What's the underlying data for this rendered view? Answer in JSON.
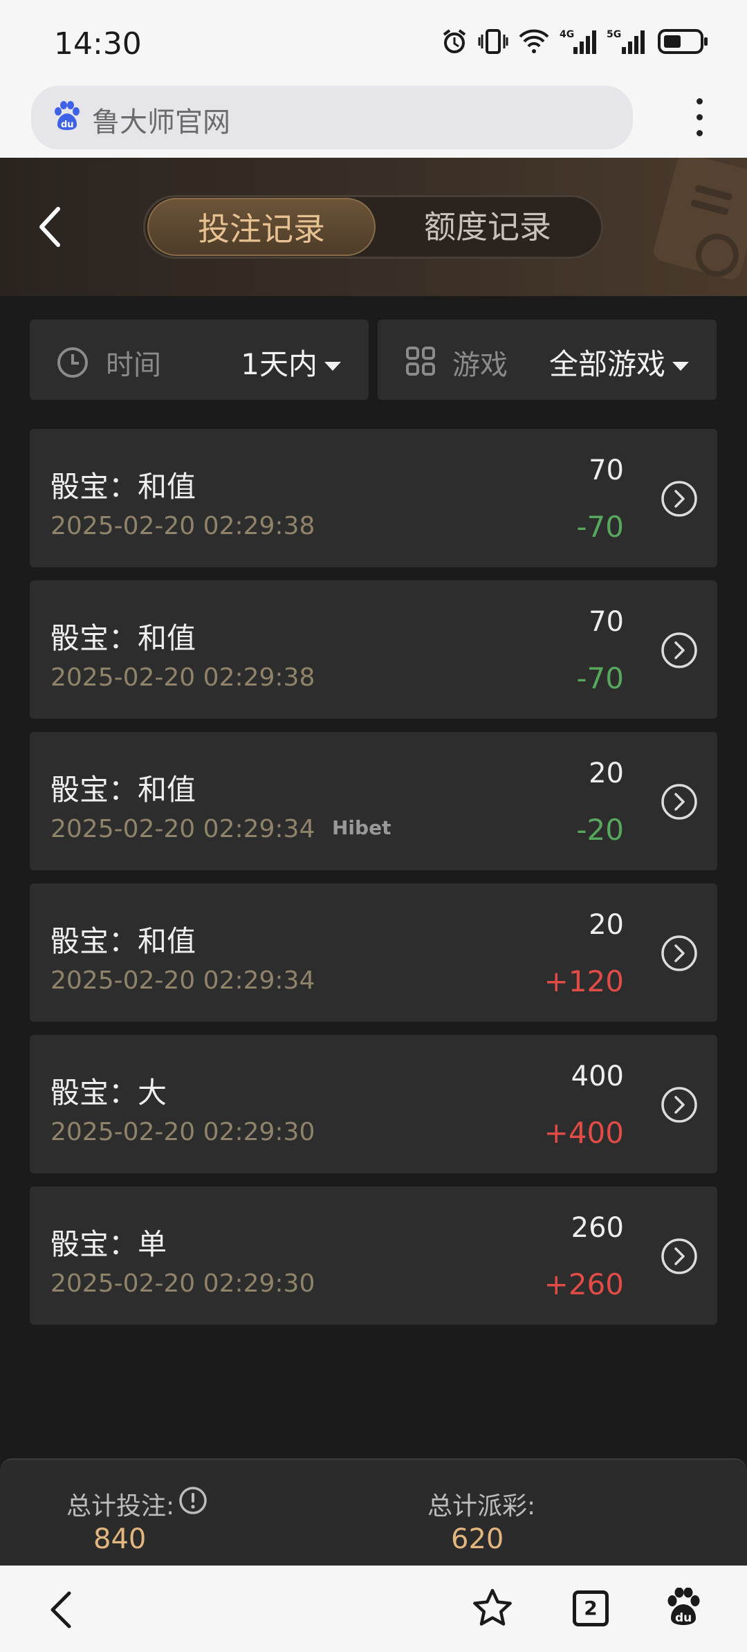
{
  "status_bar": {
    "time": "14:30",
    "icons": [
      "alarm-icon",
      "vibrate-icon",
      "wifi-icon",
      "signal-4g-icon",
      "signal-5g-icon",
      "battery-icon"
    ],
    "network_labels": [
      "4G",
      "5G"
    ]
  },
  "browser": {
    "url_text": "鲁大师官网",
    "logo": "baidu-paw-icon"
  },
  "header": {
    "tabs": [
      {
        "label": "投注记录",
        "active": true
      },
      {
        "label": "额度记录",
        "active": false
      }
    ]
  },
  "filters": {
    "time": {
      "label": "时间",
      "value": "1天内"
    },
    "game": {
      "label": "游戏",
      "value": "全部游戏"
    }
  },
  "records": [
    {
      "title": "骰宝：和值",
      "time": "2025-02-20 02:29:38",
      "amount": "70",
      "result": "-70",
      "positive": false
    },
    {
      "title": "骰宝：和值",
      "time": "2025-02-20 02:29:38",
      "amount": "70",
      "result": "-70",
      "positive": false
    },
    {
      "title": "骰宝：和值",
      "time": "2025-02-20 02:29:34",
      "amount": "20",
      "result": "-20",
      "positive": false
    },
    {
      "title": "骰宝：和值",
      "time": "2025-02-20 02:29:34",
      "amount": "20",
      "result": "+120",
      "positive": true
    },
    {
      "title": "骰宝：大",
      "time": "2025-02-20 02:29:30",
      "amount": "400",
      "result": "+400",
      "positive": true
    },
    {
      "title": "骰宝：单",
      "time": "2025-02-20 02:29:30",
      "amount": "260",
      "result": "+260",
      "positive": true
    }
  ],
  "watermark": "Hibet",
  "summary": {
    "total_bet_label": "总计投注:",
    "total_bet_value": "840",
    "total_payout_label": "总计派彩:",
    "total_payout_value": "620"
  },
  "nav": {
    "tab_count": "2"
  },
  "colors": {
    "accent_gold": "#e7c191",
    "loss_green": "#57a85c",
    "win_red": "#e24c47",
    "summary_gold": "#e2b67e"
  }
}
